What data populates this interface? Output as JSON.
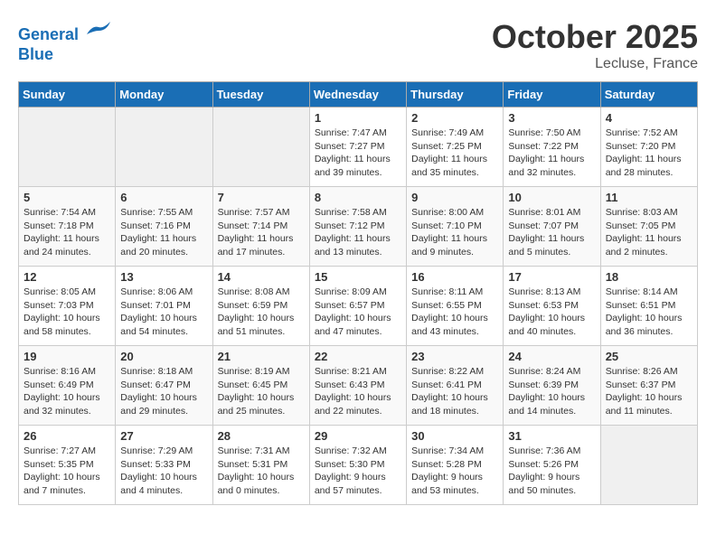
{
  "header": {
    "logo_line1": "General",
    "logo_line2": "Blue",
    "month": "October 2025",
    "location": "Lecluse, France"
  },
  "days_of_week": [
    "Sunday",
    "Monday",
    "Tuesday",
    "Wednesday",
    "Thursday",
    "Friday",
    "Saturday"
  ],
  "weeks": [
    [
      {
        "num": "",
        "empty": true
      },
      {
        "num": "",
        "empty": true
      },
      {
        "num": "",
        "empty": true
      },
      {
        "num": "1",
        "sunrise": "Sunrise: 7:47 AM",
        "sunset": "Sunset: 7:27 PM",
        "daylight": "Daylight: 11 hours and 39 minutes."
      },
      {
        "num": "2",
        "sunrise": "Sunrise: 7:49 AM",
        "sunset": "Sunset: 7:25 PM",
        "daylight": "Daylight: 11 hours and 35 minutes."
      },
      {
        "num": "3",
        "sunrise": "Sunrise: 7:50 AM",
        "sunset": "Sunset: 7:22 PM",
        "daylight": "Daylight: 11 hours and 32 minutes."
      },
      {
        "num": "4",
        "sunrise": "Sunrise: 7:52 AM",
        "sunset": "Sunset: 7:20 PM",
        "daylight": "Daylight: 11 hours and 28 minutes."
      }
    ],
    [
      {
        "num": "5",
        "sunrise": "Sunrise: 7:54 AM",
        "sunset": "Sunset: 7:18 PM",
        "daylight": "Daylight: 11 hours and 24 minutes."
      },
      {
        "num": "6",
        "sunrise": "Sunrise: 7:55 AM",
        "sunset": "Sunset: 7:16 PM",
        "daylight": "Daylight: 11 hours and 20 minutes."
      },
      {
        "num": "7",
        "sunrise": "Sunrise: 7:57 AM",
        "sunset": "Sunset: 7:14 PM",
        "daylight": "Daylight: 11 hours and 17 minutes."
      },
      {
        "num": "8",
        "sunrise": "Sunrise: 7:58 AM",
        "sunset": "Sunset: 7:12 PM",
        "daylight": "Daylight: 11 hours and 13 minutes."
      },
      {
        "num": "9",
        "sunrise": "Sunrise: 8:00 AM",
        "sunset": "Sunset: 7:10 PM",
        "daylight": "Daylight: 11 hours and 9 minutes."
      },
      {
        "num": "10",
        "sunrise": "Sunrise: 8:01 AM",
        "sunset": "Sunset: 7:07 PM",
        "daylight": "Daylight: 11 hours and 5 minutes."
      },
      {
        "num": "11",
        "sunrise": "Sunrise: 8:03 AM",
        "sunset": "Sunset: 7:05 PM",
        "daylight": "Daylight: 11 hours and 2 minutes."
      }
    ],
    [
      {
        "num": "12",
        "sunrise": "Sunrise: 8:05 AM",
        "sunset": "Sunset: 7:03 PM",
        "daylight": "Daylight: 10 hours and 58 minutes."
      },
      {
        "num": "13",
        "sunrise": "Sunrise: 8:06 AM",
        "sunset": "Sunset: 7:01 PM",
        "daylight": "Daylight: 10 hours and 54 minutes."
      },
      {
        "num": "14",
        "sunrise": "Sunrise: 8:08 AM",
        "sunset": "Sunset: 6:59 PM",
        "daylight": "Daylight: 10 hours and 51 minutes."
      },
      {
        "num": "15",
        "sunrise": "Sunrise: 8:09 AM",
        "sunset": "Sunset: 6:57 PM",
        "daylight": "Daylight: 10 hours and 47 minutes."
      },
      {
        "num": "16",
        "sunrise": "Sunrise: 8:11 AM",
        "sunset": "Sunset: 6:55 PM",
        "daylight": "Daylight: 10 hours and 43 minutes."
      },
      {
        "num": "17",
        "sunrise": "Sunrise: 8:13 AM",
        "sunset": "Sunset: 6:53 PM",
        "daylight": "Daylight: 10 hours and 40 minutes."
      },
      {
        "num": "18",
        "sunrise": "Sunrise: 8:14 AM",
        "sunset": "Sunset: 6:51 PM",
        "daylight": "Daylight: 10 hours and 36 minutes."
      }
    ],
    [
      {
        "num": "19",
        "sunrise": "Sunrise: 8:16 AM",
        "sunset": "Sunset: 6:49 PM",
        "daylight": "Daylight: 10 hours and 32 minutes."
      },
      {
        "num": "20",
        "sunrise": "Sunrise: 8:18 AM",
        "sunset": "Sunset: 6:47 PM",
        "daylight": "Daylight: 10 hours and 29 minutes."
      },
      {
        "num": "21",
        "sunrise": "Sunrise: 8:19 AM",
        "sunset": "Sunset: 6:45 PM",
        "daylight": "Daylight: 10 hours and 25 minutes."
      },
      {
        "num": "22",
        "sunrise": "Sunrise: 8:21 AM",
        "sunset": "Sunset: 6:43 PM",
        "daylight": "Daylight: 10 hours and 22 minutes."
      },
      {
        "num": "23",
        "sunrise": "Sunrise: 8:22 AM",
        "sunset": "Sunset: 6:41 PM",
        "daylight": "Daylight: 10 hours and 18 minutes."
      },
      {
        "num": "24",
        "sunrise": "Sunrise: 8:24 AM",
        "sunset": "Sunset: 6:39 PM",
        "daylight": "Daylight: 10 hours and 14 minutes."
      },
      {
        "num": "25",
        "sunrise": "Sunrise: 8:26 AM",
        "sunset": "Sunset: 6:37 PM",
        "daylight": "Daylight: 10 hours and 11 minutes."
      }
    ],
    [
      {
        "num": "26",
        "sunrise": "Sunrise: 7:27 AM",
        "sunset": "Sunset: 5:35 PM",
        "daylight": "Daylight: 10 hours and 7 minutes."
      },
      {
        "num": "27",
        "sunrise": "Sunrise: 7:29 AM",
        "sunset": "Sunset: 5:33 PM",
        "daylight": "Daylight: 10 hours and 4 minutes."
      },
      {
        "num": "28",
        "sunrise": "Sunrise: 7:31 AM",
        "sunset": "Sunset: 5:31 PM",
        "daylight": "Daylight: 10 hours and 0 minutes."
      },
      {
        "num": "29",
        "sunrise": "Sunrise: 7:32 AM",
        "sunset": "Sunset: 5:30 PM",
        "daylight": "Daylight: 9 hours and 57 minutes."
      },
      {
        "num": "30",
        "sunrise": "Sunrise: 7:34 AM",
        "sunset": "Sunset: 5:28 PM",
        "daylight": "Daylight: 9 hours and 53 minutes."
      },
      {
        "num": "31",
        "sunrise": "Sunrise: 7:36 AM",
        "sunset": "Sunset: 5:26 PM",
        "daylight": "Daylight: 9 hours and 50 minutes."
      },
      {
        "num": "",
        "empty": true
      }
    ]
  ]
}
